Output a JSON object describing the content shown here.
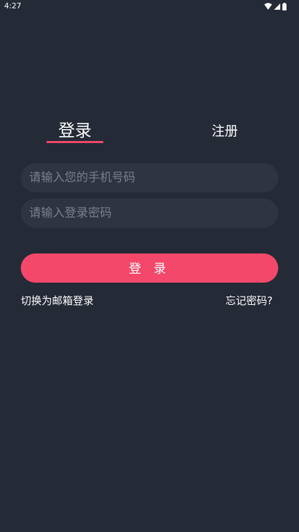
{
  "status_bar": {
    "time": "4:27"
  },
  "tabs": {
    "login_label": "登录",
    "register_label": "注册",
    "active_color": "#f3486a"
  },
  "form": {
    "phone_placeholder": "请输入您的手机号码",
    "password_placeholder": "请输入登录密码",
    "login_button_label": "登 录"
  },
  "links": {
    "switch_email": "切换为邮箱登录",
    "forgot_password": "忘记密码?"
  },
  "colors": {
    "background": "#252a37",
    "input_background": "#2f3441",
    "accent": "#f3486a"
  }
}
